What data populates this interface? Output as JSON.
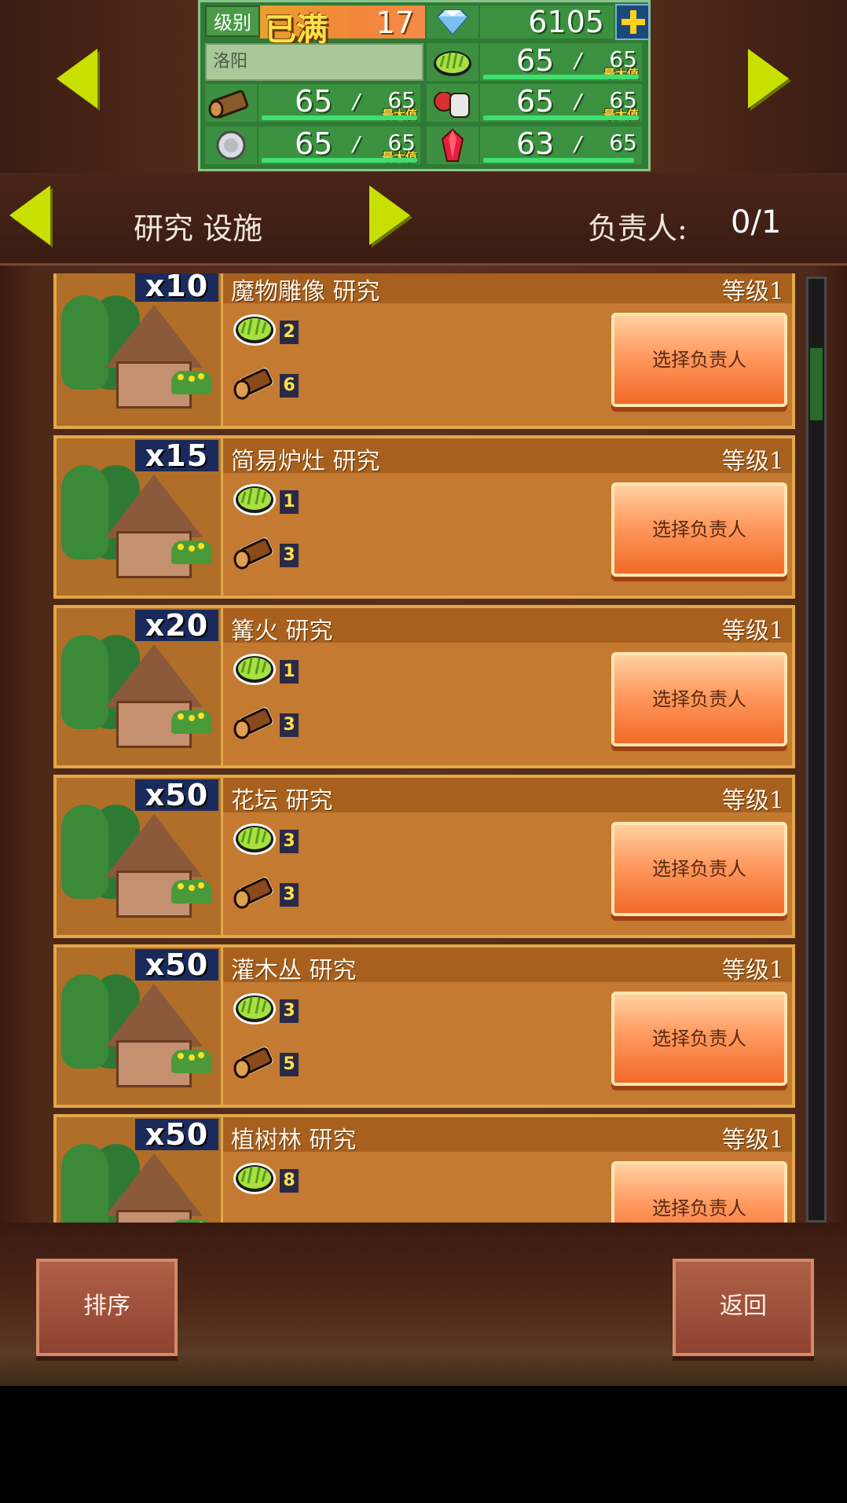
{
  "status": {
    "level_label": "级别",
    "level_maxed": "已满",
    "level_value": "17",
    "gems": "6105",
    "city": "洛阳",
    "max_label": "最大值",
    "resources": [
      {
        "icon": "grass-icon",
        "current": "65",
        "max": "65",
        "fill": 1.0
      },
      {
        "icon": "wood-log-icon",
        "current": "65",
        "max": "65",
        "fill": 1.0
      },
      {
        "icon": "food-meat-icon",
        "current": "65",
        "max": "65",
        "fill": 1.0
      },
      {
        "icon": "silver-coin-icon",
        "current": "65",
        "max": "65",
        "fill": 1.0
      },
      {
        "icon": "red-gem-icon",
        "current": "63",
        "max": "65",
        "fill": 0.97
      }
    ]
  },
  "header": {
    "title": "研究 设施",
    "manager_label": "负责人:",
    "manager_count": "0/1"
  },
  "cards": [
    {
      "mult": "x10",
      "title": "魔物雕像 研究",
      "level": "等级1",
      "grass": "2",
      "wood": "6",
      "button": "选择负责人"
    },
    {
      "mult": "x15",
      "title": "简易炉灶 研究",
      "level": "等级1",
      "grass": "1",
      "wood": "3",
      "button": "选择负责人"
    },
    {
      "mult": "x20",
      "title": "篝火 研究",
      "level": "等级1",
      "grass": "1",
      "wood": "3",
      "button": "选择负责人"
    },
    {
      "mult": "x50",
      "title": "花坛 研究",
      "level": "等级1",
      "grass": "3",
      "wood": "3",
      "button": "选择负责人"
    },
    {
      "mult": "x50",
      "title": "灌木丛 研究",
      "level": "等级1",
      "grass": "3",
      "wood": "5",
      "button": "选择负责人"
    },
    {
      "mult": "x50",
      "title": "植树林 研究",
      "level": "等级1",
      "grass": "8",
      "wood": "",
      "button": "选择负责人"
    }
  ],
  "bottom": {
    "sort_label": "排序",
    "back_label": "返回"
  },
  "scroll": {
    "position": 0.07
  }
}
